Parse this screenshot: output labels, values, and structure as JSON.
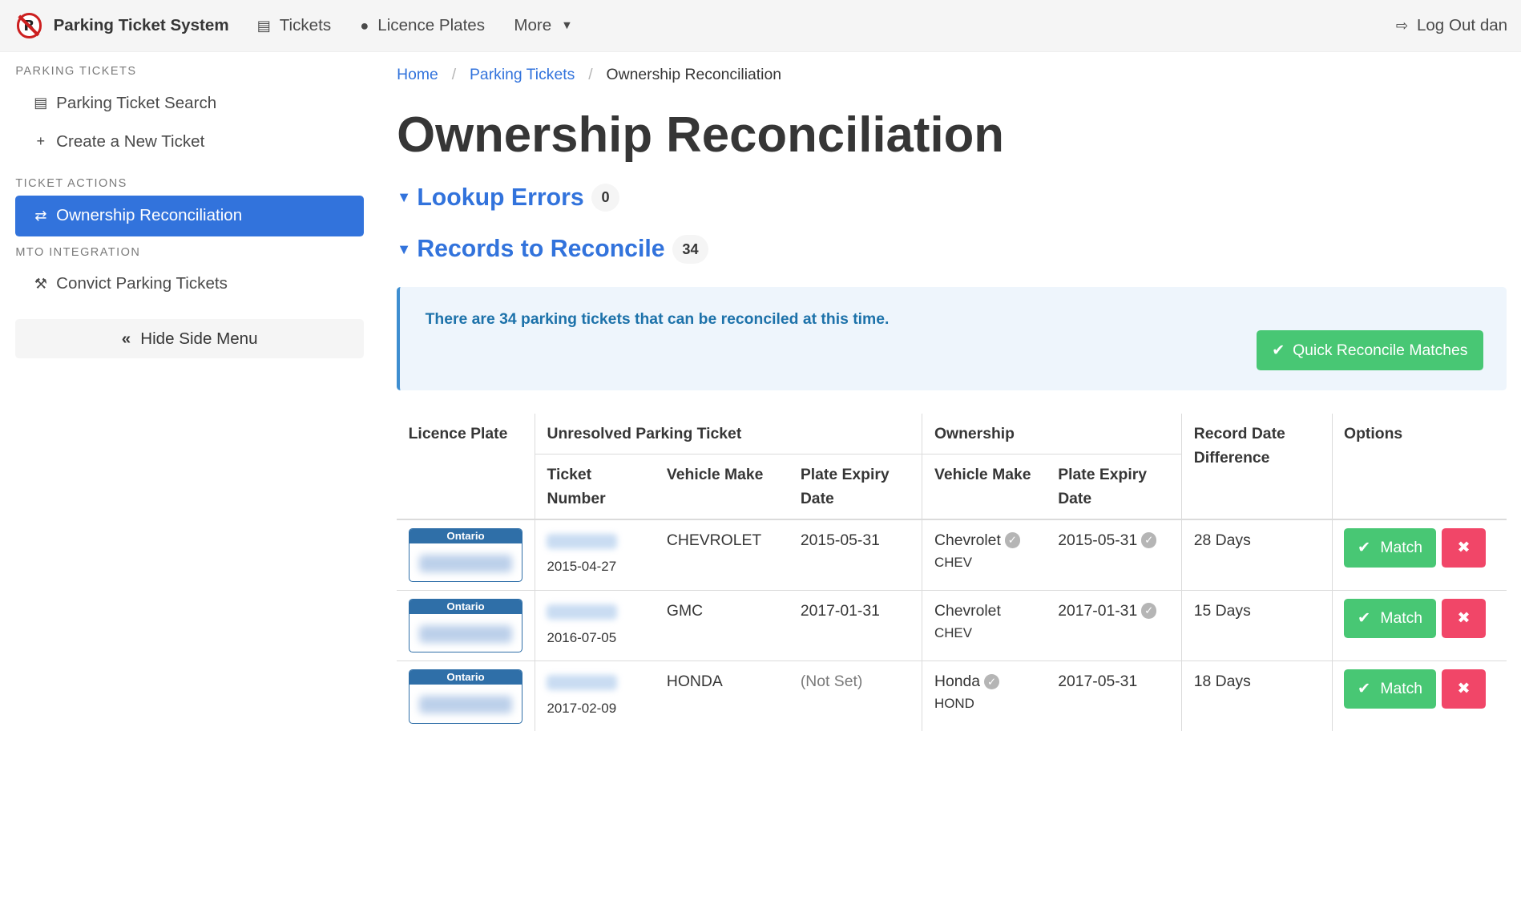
{
  "nav": {
    "brand": "Parking Ticket System",
    "logo_letter": "R",
    "items": [
      {
        "label": "Tickets",
        "icon": "file-icon"
      },
      {
        "label": "Licence Plates",
        "icon": "car-icon"
      },
      {
        "label": "More",
        "icon": "chevron-down-icon"
      }
    ],
    "logout": "Log Out dan"
  },
  "sidebar": {
    "sections": [
      {
        "label": "Parking Tickets",
        "items": [
          "Parking Ticket Search",
          "Create a New Ticket"
        ]
      },
      {
        "label": "Ticket Actions",
        "items": [
          "Ownership Reconciliation"
        ]
      },
      {
        "label": "MTO Integration",
        "items": [
          "Convict Parking Tickets"
        ]
      }
    ],
    "hide_label": "Hide Side Menu"
  },
  "breadcrumb": {
    "home": "Home",
    "parent": "Parking Tickets",
    "current": "Ownership Reconciliation"
  },
  "page_title": "Ownership Reconciliation",
  "lookup_errors": {
    "title": "Lookup Errors",
    "count": "0"
  },
  "records": {
    "title": "Records to Reconcile",
    "count": "34"
  },
  "notice": {
    "text": "There are 34 parking tickets that can be reconciled at this time.",
    "button": "Quick Reconcile Matches"
  },
  "table": {
    "headers": {
      "licence_plate": "Licence Plate",
      "unresolved": "Unresolved Parking Ticket",
      "ownership": "Ownership",
      "record_date_diff": "Record Date Difference",
      "options": "Options",
      "ticket_number": "Ticket Number",
      "vehicle_make": "Vehicle Make",
      "plate_expiry": "Plate Expiry Date",
      "own_vehicle_make": "Vehicle Make",
      "own_plate_expiry": "Plate Expiry Date"
    },
    "plate_province": "Ontario",
    "match_label": "Match",
    "rows": [
      {
        "ticket_date": "2015-04-27",
        "make": "CHEVROLET",
        "expiry": "2015-05-31",
        "own_make": "Chevrolet",
        "own_make_code": "CHEV",
        "own_expiry": "2015-05-31",
        "diff": "28 Days"
      },
      {
        "ticket_date": "2016-07-05",
        "make": "GMC",
        "expiry": "2017-01-31",
        "own_make": "Chevrolet",
        "own_make_code": "CHEV",
        "own_expiry": "2017-01-31",
        "diff": "15 Days"
      },
      {
        "ticket_date": "2017-02-09",
        "make": "HONDA",
        "expiry": "(Not Set)",
        "own_make": "Honda",
        "own_make_code": "HOND",
        "own_expiry": "2017-05-31",
        "diff": "18 Days"
      }
    ]
  }
}
